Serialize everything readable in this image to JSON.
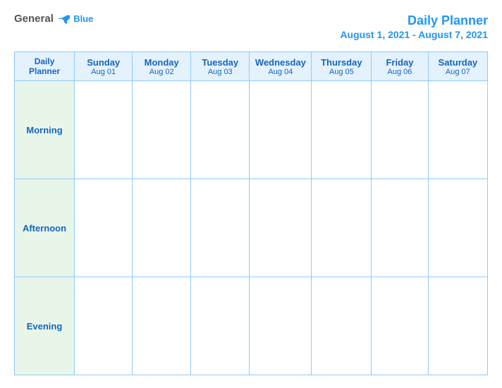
{
  "logo": {
    "general_text": "General",
    "blue_text": "Blue"
  },
  "header": {
    "title": "Daily Planner",
    "subtitle": "August 1, 2021 - August 7, 2021"
  },
  "columns": [
    {
      "id": "daily-planner-col",
      "name": "Daily\nPlanner",
      "date": ""
    },
    {
      "id": "sunday-col",
      "name": "Sunday",
      "date": "Aug 01"
    },
    {
      "id": "monday-col",
      "name": "Monday",
      "date": "Aug 02"
    },
    {
      "id": "tuesday-col",
      "name": "Tuesday",
      "date": "Aug 03"
    },
    {
      "id": "wednesday-col",
      "name": "Wednesday",
      "date": "Aug 04"
    },
    {
      "id": "thursday-col",
      "name": "Thursday",
      "date": "Aug 05"
    },
    {
      "id": "friday-col",
      "name": "Friday",
      "date": "Aug 06"
    },
    {
      "id": "saturday-col",
      "name": "Saturday",
      "date": "Aug 07"
    }
  ],
  "rows": [
    {
      "id": "morning-row",
      "label": "Morning"
    },
    {
      "id": "afternoon-row",
      "label": "Afternoon"
    },
    {
      "id": "evening-row",
      "label": "Evening"
    }
  ]
}
